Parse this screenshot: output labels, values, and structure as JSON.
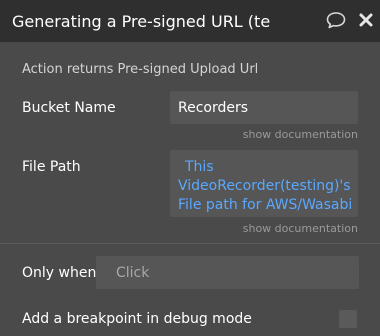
{
  "header": {
    "title": "Generating a Pre-signed URL (te",
    "icons": [
      "comment-icon",
      "close-icon"
    ]
  },
  "action_info": "Action returns Pre-signed Upload Url",
  "fields": {
    "bucket": {
      "label": "Bucket Name",
      "value": "Recorders",
      "doc": "show documentation"
    },
    "filepath": {
      "label": "File Path",
      "value_line1": "This",
      "value_line2": "VideoRecorder(testing)'s",
      "value_line3": "File path for AWS/Wasabi",
      "doc": "show documentation"
    }
  },
  "only_when": {
    "label": "Only when",
    "placeholder": "Click"
  },
  "breakpoint": {
    "label": "Add a breakpoint in debug mode"
  }
}
